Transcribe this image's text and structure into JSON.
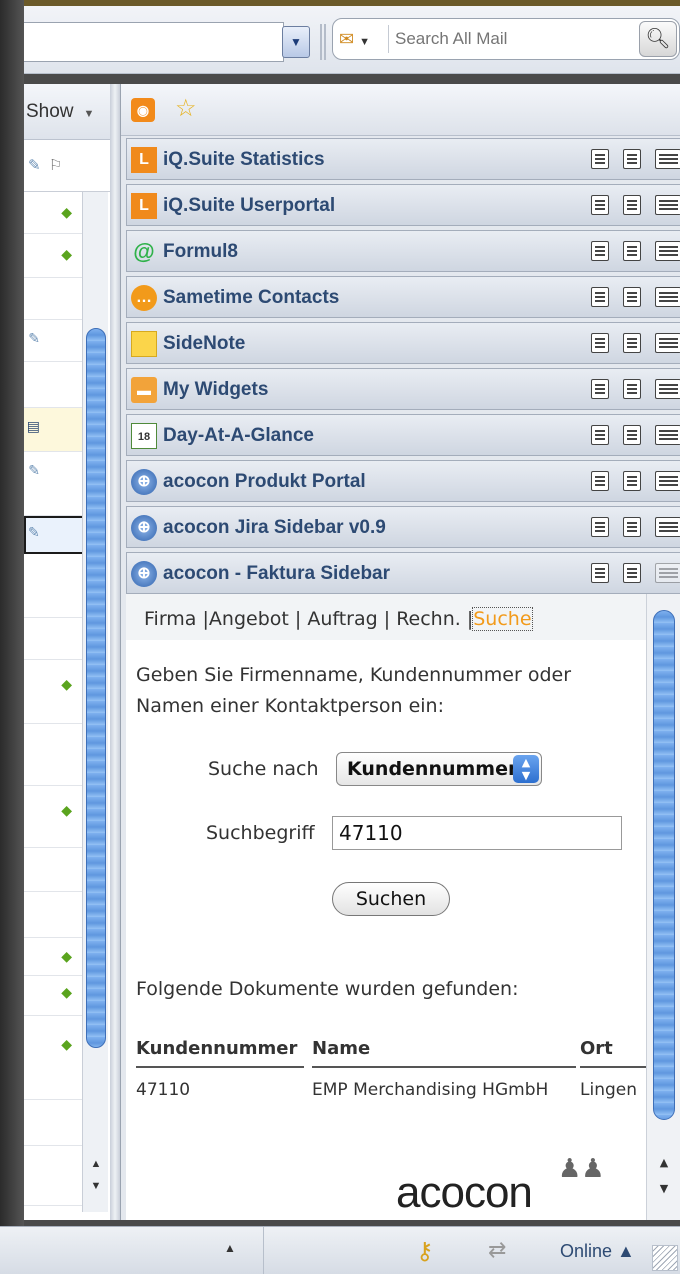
{
  "toolbar": {
    "search_placeholder": "Search All Mail"
  },
  "mail_list": {
    "show_label": "Show"
  },
  "widgets": [
    {
      "title": "iQ.Suite Statistics",
      "icon": "iq-suite-logo-icon"
    },
    {
      "title": "iQ.Suite Userportal",
      "icon": "iq-suite-logo-icon"
    },
    {
      "title": "Formul8",
      "icon": "at-sign-icon"
    },
    {
      "title": "Sametime Contacts",
      "icon": "sametime-bubble-icon"
    },
    {
      "title": "SideNote",
      "icon": "note-icon"
    },
    {
      "title": "My Widgets",
      "icon": "toolbox-icon"
    },
    {
      "title": "Day-At-A-Glance",
      "icon": "calendar-icon"
    },
    {
      "title": "acocon Produkt Portal",
      "icon": "globe-icon"
    },
    {
      "title": "acocon Jira Sidebar v0.9",
      "icon": "globe-icon"
    },
    {
      "title": "acocon - Faktura Sidebar",
      "icon": "globe-icon"
    }
  ],
  "faktura": {
    "nav": {
      "firma": "Firma |",
      "angebot": "Angebot |",
      "auftrag": "Auftrag |",
      "rechn": "Rechn. |",
      "suche": "Suche"
    },
    "intro": "Geben Sie Firmenname, Kundennummer oder Namen einer Kontaktperson ein:",
    "search_by_label": "Suche nach",
    "search_by_value": "Kundennummer",
    "term_label": "Suchbegriff",
    "term_value": "47110",
    "search_button": "Suchen",
    "found_text": "Folgende Dokumente wurden gefunden:",
    "table": {
      "headers": [
        "Kundennummer",
        "Name",
        "Ort"
      ],
      "rows": [
        [
          "47110",
          "EMP Merchandising HGmbH",
          "Lingen"
        ]
      ]
    },
    "logo_text": "acocon"
  },
  "status": {
    "online_label": "Online ▲"
  },
  "colors": {
    "widget_title": "#2d4a73",
    "active_tab": "#f29a1a",
    "scroll_thumb": "#5f97df"
  }
}
